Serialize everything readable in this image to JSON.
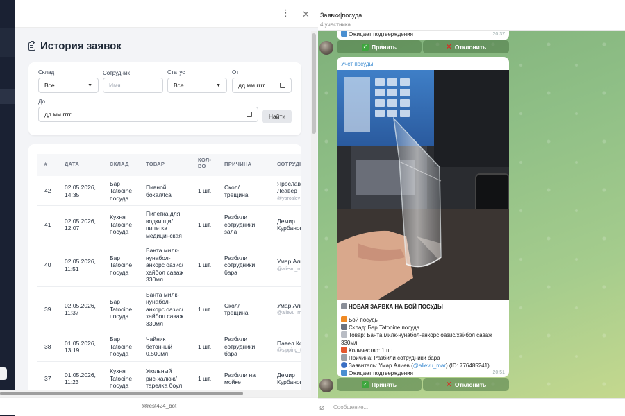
{
  "telegram": {
    "chat_title": "Заявки|посуда",
    "chat_subtitle": "4 участника",
    "prev_message": {
      "text": "Ожидает подтверждения",
      "time": "20:37"
    },
    "accept_label": "Принять",
    "reject_label": "Отклонить",
    "message": {
      "sender": "Учет посуды",
      "lines": {
        "heading": "НОВАЯ ЗАЯВКА НА БОЙ ПОСУДЫ",
        "type": "Бой посуды",
        "warehouse": "Склад: Бар Tatooine посуда",
        "product": "Товар: Банта милк-нунабол-анкорс оазис/хайбол саваж 330мл",
        "quantity": "Количество: 1 шт.",
        "reason": "Причина: Разбили сотрудники бара",
        "applicant_prefix": "Заявитель: Умар Алиев (",
        "applicant_link": "@alievu_mar",
        "applicant_suffix": ") (ID: 776485241)",
        "status": "Ожидает подтверждения"
      },
      "time": "20:51"
    },
    "input_placeholder": "Сообщение..."
  },
  "app": {
    "title": "История заявок",
    "filters": {
      "warehouse_label": "Склад",
      "warehouse_value": "Все",
      "employee_label": "Сотрудник",
      "employee_placeholder": "Имя...",
      "status_label": "Статус",
      "status_value": "Все",
      "from_label": "От",
      "from_value": "дд.мм.гггг",
      "to_label": "До",
      "to_value": "дд.мм.гггг",
      "find_label": "Найти"
    },
    "columns": [
      "#",
      "ДАТА",
      "СКЛАД",
      "ТОВАР",
      "КОЛ-\nВО",
      "ПРИЧИНА",
      "СОТРУДНИК"
    ],
    "rows": [
      {
        "id": "42",
        "date": "02.05.2026,\n14:35",
        "warehouse": "Бар\nTatooine\nпосуда",
        "product": "Пивной\nбокал/Іса",
        "qty": "1 шт.",
        "reason": "Скол/\nтрещина",
        "employee": "Ярослав\nЛеавер",
        "handle": "@yaroslev"
      },
      {
        "id": "41",
        "date": "02.05.2026,\n12:07",
        "warehouse": "Кухня\nTatooine\nпосуда",
        "product": "Пипетка для\nводки щи/\nпипетка\nмедицинская",
        "qty": "1 шт.",
        "reason": "Разбили\nсотрудники\nзала",
        "employee": "Демир\nКурбанов",
        "handle": ""
      },
      {
        "id": "40",
        "date": "02.05.2026,\n11:51",
        "warehouse": "Бар\nTatooine\nпосуда",
        "product": "Банта милк-\nнунабол-\nанкорс оазис/\nхайбол саваж\n330мл",
        "qty": "1 шт.",
        "reason": "Разбили\nсотрудники\nбара",
        "employee": "Умар Алиев",
        "handle": "@alievu_mar"
      },
      {
        "id": "39",
        "date": "02.05.2026,\n11:37",
        "warehouse": "Бар\nTatooine\nпосуда",
        "product": "Банта милк-\nнунабол-\nанкорс оазис/\nхайбол саваж\n330мл",
        "qty": "1 шт.",
        "reason": "Скол/\nтрещина",
        "employee": "Умар Алиев",
        "handle": "@alievu_mar"
      },
      {
        "id": "38",
        "date": "01.05.2026,\n13:19",
        "warehouse": "Бар\nTatooine\nпосуда",
        "product": "Чайник\nбетонный\n0.500мл",
        "qty": "1 шт.",
        "reason": "Разбили\nсотрудники\nбара",
        "employee": "Павел Король",
        "handle": "@sipping_tea"
      },
      {
        "id": "37",
        "date": "01.05.2026,\n11:23",
        "warehouse": "Кухня\nTatooine\nпосуда",
        "product": "Угольный\nрис-халюж/\nтарелка боул",
        "qty": "1 шт.",
        "reason": "Разбили на\nмойке",
        "employee": "Демир\nКурбанов",
        "handle": ""
      }
    ],
    "bot_name": "@rest424_bot"
  }
}
